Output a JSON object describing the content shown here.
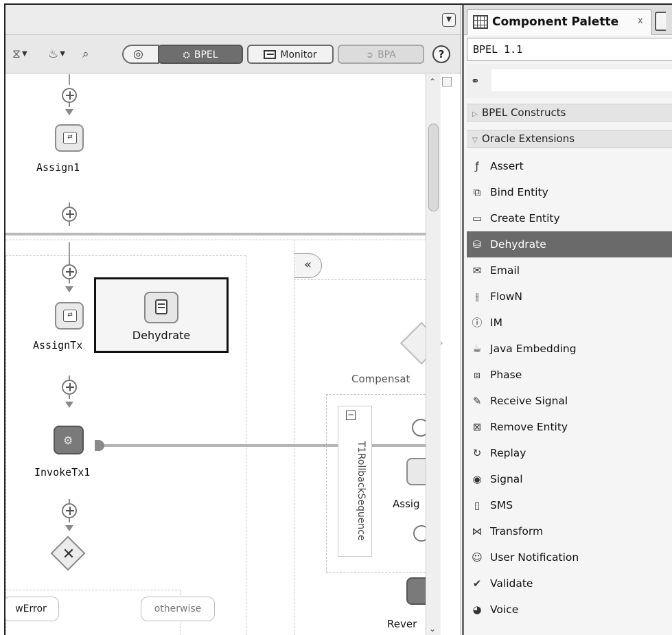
{
  "editor": {
    "toolbar": {
      "bpel_label": "BPEL",
      "monitor_label": "Monitor",
      "bpa_label": "BPA",
      "help_label": "?"
    },
    "nodes": {
      "assign1": "Assign1",
      "assign_tx": "AssignTx",
      "invoke_tx1": "InvokeTx1",
      "compensate": "Compensat",
      "rollback_sequence": "T1RollbackSequence",
      "assign_partial": "Assig",
      "reverse_partial": "Rever"
    },
    "cases": {
      "error_case": "wError",
      "otherwise": "otherwise"
    },
    "drag_item": "Dehydrate",
    "collapse_glyph": "«"
  },
  "palette": {
    "tab_title": "Component Palette",
    "tab_close": "x",
    "selected_catalog": "BPEL 1.1",
    "search_placeholder": "",
    "groups": [
      {
        "label": "BPEL Constructs",
        "expanded": false
      },
      {
        "label": "Oracle Extensions",
        "expanded": true
      }
    ],
    "items": [
      {
        "label": "Assert",
        "icon": "assert-icon",
        "glyph": "ƒ"
      },
      {
        "label": "Bind Entity",
        "icon": "bind-entity-icon",
        "glyph": "⧉"
      },
      {
        "label": "Create Entity",
        "icon": "create-entity-icon",
        "glyph": "▭"
      },
      {
        "label": "Dehydrate",
        "icon": "dehydrate-icon",
        "glyph": "⛁",
        "selected": true
      },
      {
        "label": "Email",
        "icon": "email-icon",
        "glyph": "✉"
      },
      {
        "label": "FlowN",
        "icon": "flown-icon",
        "glyph": "⫲"
      },
      {
        "label": "IM",
        "icon": "im-icon",
        "glyph": "ⓘ"
      },
      {
        "label": "Java Embedding",
        "icon": "java-embedding-icon",
        "glyph": "☕"
      },
      {
        "label": "Phase",
        "icon": "phase-icon",
        "glyph": "⧈"
      },
      {
        "label": "Receive Signal",
        "icon": "receive-signal-icon",
        "glyph": "✎"
      },
      {
        "label": "Remove Entity",
        "icon": "remove-entity-icon",
        "glyph": "⊠"
      },
      {
        "label": "Replay",
        "icon": "replay-icon",
        "glyph": "↻"
      },
      {
        "label": "Signal",
        "icon": "signal-icon",
        "glyph": "◉"
      },
      {
        "label": "SMS",
        "icon": "sms-icon",
        "glyph": "▯"
      },
      {
        "label": "Transform",
        "icon": "transform-icon",
        "glyph": "⋈"
      },
      {
        "label": "User Notification",
        "icon": "user-notification-icon",
        "glyph": "☺"
      },
      {
        "label": "Validate",
        "icon": "validate-icon",
        "glyph": "✔"
      },
      {
        "label": "Voice",
        "icon": "voice-icon",
        "glyph": "◕"
      }
    ]
  }
}
